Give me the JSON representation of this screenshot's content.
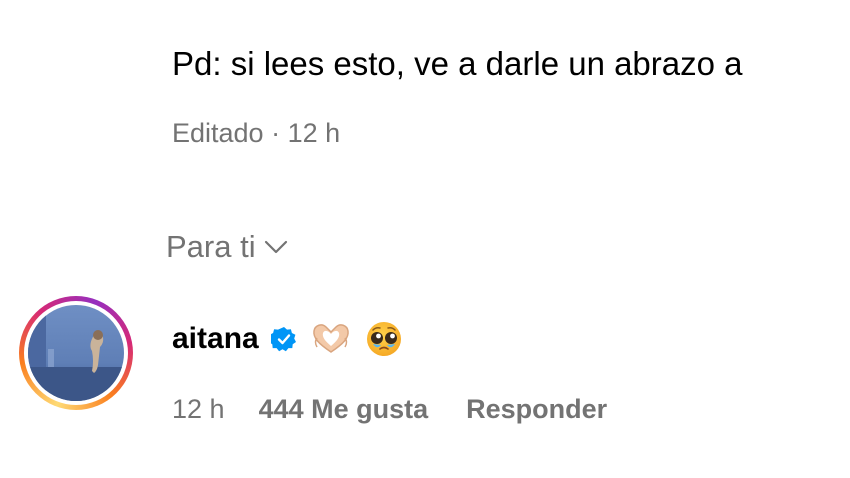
{
  "caption": {
    "text": "Pd: si lees esto, ve a darle un abrazo a",
    "meta": "Editado · 12 h"
  },
  "sort": {
    "label": "Para ti",
    "icon": "chevron-down-icon"
  },
  "comment": {
    "username": "aitana",
    "verified_icon": "verified-badge-icon",
    "emojis": [
      "heart-hands-emoji",
      "pleading-face-emoji"
    ],
    "time": "12 h",
    "likes": "444 Me gusta",
    "reply": "Responder"
  },
  "colors": {
    "secondary_text": "#737373",
    "verified_blue": "#0095f6"
  }
}
